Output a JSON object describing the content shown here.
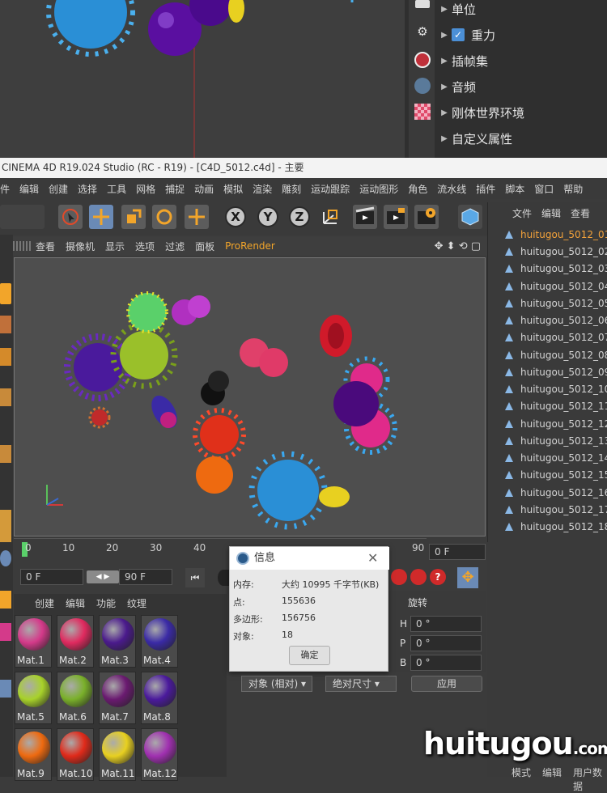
{
  "attributes": {
    "rows": [
      {
        "label": "单位",
        "checked": false
      },
      {
        "label": "重力",
        "checked": true
      },
      {
        "label": "插帧集",
        "checked": false
      },
      {
        "label": "音频",
        "checked": false
      },
      {
        "label": "刚体世界环境",
        "checked": false
      },
      {
        "label": "自定义属性",
        "checked": false
      }
    ]
  },
  "window": {
    "title": "CINEMA 4D R19.024 Studio (RC - R19) - [C4D_5012.c4d] - 主要"
  },
  "menubar": [
    "件",
    "编辑",
    "创建",
    "选择",
    "工具",
    "网格",
    "捕捉",
    "动画",
    "模拟",
    "渲染",
    "雕刻",
    "运动跟踪",
    "运动图形",
    "角色",
    "流水线",
    "插件",
    "脚本",
    "窗口",
    "帮助"
  ],
  "toolbar": {
    "x": "X",
    "y": "Y",
    "z": "Z"
  },
  "viewport_menu": [
    "查看",
    "摄像机",
    "显示",
    "选项",
    "过滤",
    "面板",
    "ProRender"
  ],
  "timeline": {
    "ticks": [
      "0",
      "10",
      "20",
      "30",
      "40",
      "90"
    ],
    "end_field": "0 F"
  },
  "transport": {
    "start": "0 F",
    "end": "90 F"
  },
  "materials": {
    "menu": [
      "创建",
      "编辑",
      "功能",
      "纹理"
    ],
    "items": [
      {
        "name": "Mat.1",
        "color": "#d43a8a"
      },
      {
        "name": "Mat.2",
        "color": "#e02a5f"
      },
      {
        "name": "Mat.3",
        "color": "#4a1a8c"
      },
      {
        "name": "Mat.4",
        "color": "#3a2aa6"
      },
      {
        "name": "Mat.5",
        "color": "#a8d22a"
      },
      {
        "name": "Mat.6",
        "color": "#7ab02a"
      },
      {
        "name": "Mat.7",
        "color": "#6a1a70"
      },
      {
        "name": "Mat.8",
        "color": "#4a1a9c"
      },
      {
        "name": "Mat.9",
        "color": "#ee6a10"
      },
      {
        "name": "Mat.10",
        "color": "#e02a1a"
      },
      {
        "name": "Mat.11",
        "color": "#e8d020"
      },
      {
        "name": "Mat.12",
        "color": "#a030b0"
      }
    ]
  },
  "coordinates": {
    "header": "旋转",
    "fields": [
      {
        "axis": "H",
        "value": "0 °"
      },
      {
        "axis": "P",
        "value": "0 °"
      },
      {
        "axis": "B",
        "value": "0 °"
      }
    ],
    "mode_select": "对象 (相对)",
    "size_select": "绝对尺寸",
    "apply": "应用"
  },
  "objects": {
    "tabs": [
      "文件",
      "编辑",
      "查看"
    ],
    "items": [
      "huitugou_5012_01",
      "huitugou_5012_02",
      "huitugou_5012_03",
      "huitugou_5012_04",
      "huitugou_5012_05",
      "huitugou_5012_06",
      "huitugou_5012_07",
      "huitugou_5012_08",
      "huitugou_5012_09",
      "huitugou_5012_10",
      "huitugou_5012_11",
      "huitugou_5012_12",
      "huitugou_5012_13",
      "huitugou_5012_14",
      "huitugou_5012_15",
      "huitugou_5012_16",
      "huitugou_5012_17",
      "huitugou_5012_18"
    ],
    "selected_index": 0,
    "bottom_tabs": [
      "模式",
      "编辑",
      "用户数据"
    ]
  },
  "info_dialog": {
    "title": "信息",
    "rows": [
      {
        "label": "内存:",
        "value": "大约 10995 千字节(KB)"
      },
      {
        "label": "点:",
        "value": "155636"
      },
      {
        "label": "多边形:",
        "value": "156756"
      },
      {
        "label": "对象:",
        "value": "18"
      }
    ],
    "ok": "确定"
  },
  "watermark": {
    "main": "huitugou",
    "suffix": ".com"
  }
}
